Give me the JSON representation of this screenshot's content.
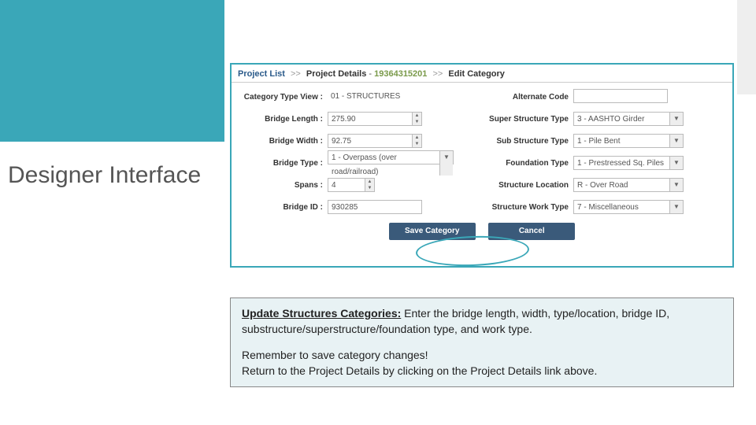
{
  "slide_title": "Designer Interface",
  "breadcrumb": {
    "project_list": "Project List",
    "project_details": "Project Details",
    "project_id": "19364315201",
    "current": "Edit Category",
    "sep": ">>"
  },
  "left_fields": {
    "category_type_view": {
      "label": "Category Type View :",
      "value": "01 - STRUCTURES"
    },
    "bridge_length": {
      "label": "Bridge Length :",
      "value": "275.90"
    },
    "bridge_width": {
      "label": "Bridge Width :",
      "value": "92.75"
    },
    "bridge_type": {
      "label": "Bridge Type :",
      "value": "1 - Overpass (over road/railroad)"
    },
    "spans": {
      "label": "Spans :",
      "value": "4"
    },
    "bridge_id": {
      "label": "Bridge ID :",
      "value": "930285"
    }
  },
  "right_fields": {
    "alternate_code": {
      "label": "Alternate Code",
      "value": ""
    },
    "super_structure": {
      "label": "Super Structure Type",
      "value": "3 - AASHTO Girder"
    },
    "sub_structure": {
      "label": "Sub Structure Type",
      "value": "1 - Pile Bent"
    },
    "foundation": {
      "label": "Foundation Type",
      "value": "1 - Prestressed Sq. Piles"
    },
    "location": {
      "label": "Structure Location",
      "value": "R - Over Road"
    },
    "work_type": {
      "label": "Structure Work Type",
      "value": "7 - Miscellaneous"
    }
  },
  "buttons": {
    "save": "Save Category",
    "cancel": "Cancel"
  },
  "instructions": {
    "heading": "Update Structures Categories:",
    "line1_rest": " Enter the bridge length, width, type/location, bridge ID, substructure/superstructure/foundation type, and work type.",
    "line2": "Remember to save category changes!",
    "line3": "Return to the Project Details by clicking on the Project Details link above."
  }
}
